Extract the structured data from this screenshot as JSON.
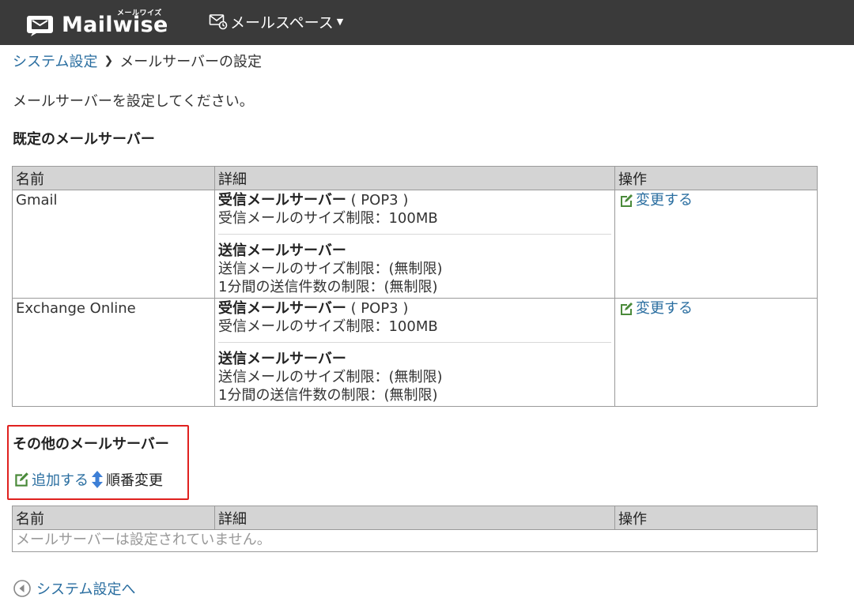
{
  "header": {
    "logo_ruby": "メールワイズ",
    "logo_text": "Mailwise",
    "space_menu_label": "メールスペース"
  },
  "breadcrumb": {
    "parent": "システム設定",
    "current": "メールサーバーの設定"
  },
  "intro": "メールサーバーを設定してください。",
  "default_section": {
    "title": "既定のメールサーバー",
    "columns": [
      "名前",
      "詳細",
      "操作"
    ],
    "rows": [
      {
        "name": "Gmail",
        "incoming_title": "受信メールサーバー",
        "incoming_protocol": "( POP3 )",
        "incoming_size": "受信メールのサイズ制限：100MB",
        "outgoing_title": "送信メールサーバー",
        "outgoing_size": "送信メールのサイズ制限：(無制限)",
        "outgoing_count": "1分間の送信件数の制限：(無制限)",
        "action": "変更する"
      },
      {
        "name": "Exchange Online",
        "incoming_title": "受信メールサーバー",
        "incoming_protocol": "( POP3 )",
        "incoming_size": "受信メールのサイズ制限：100MB",
        "outgoing_title": "送信メールサーバー",
        "outgoing_size": "送信メールのサイズ制限：(無制限)",
        "outgoing_count": "1分間の送信件数の制限：(無制限)",
        "action": "変更する"
      }
    ]
  },
  "other_section": {
    "title": "その他のメールサーバー",
    "add_label": "追加する",
    "order_label": "順番変更",
    "columns": [
      "名前",
      "詳細",
      "操作"
    ],
    "empty_message": "メールサーバーは設定されていません。"
  },
  "back_link": "システム設定へ",
  "colors": {
    "topbar": "#3a3a3a",
    "link": "#2a6ea0",
    "highlight": "#e0211f",
    "table_header": "#d4d4d4"
  }
}
